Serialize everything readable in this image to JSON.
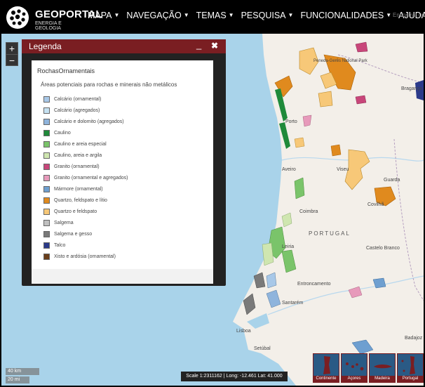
{
  "brand": {
    "title": "GEOPORTAL",
    "subtitle": "ENERGIA E GEOLOGIA"
  },
  "nav": {
    "items": [
      {
        "label": "MAPA",
        "dropdown": true
      },
      {
        "label": "NAVEGAÇÃO",
        "dropdown": true
      },
      {
        "label": "TEMAS",
        "dropdown": true
      },
      {
        "label": "PESQUISA",
        "dropdown": true
      },
      {
        "label": "FUNCIONALIDADES",
        "dropdown": true
      },
      {
        "label": "AJUDA",
        "dropdown": false
      }
    ],
    "search_placeholder": "Encontrar um"
  },
  "zoom": {
    "in": "+",
    "out": "−"
  },
  "legend": {
    "title": "Legenda",
    "minimize": "_",
    "close": "✖",
    "layer_name": "RochasOrnamentais",
    "subtitle": "Áreas potenciais para rochas e minerais não metálicos",
    "items": [
      {
        "label": "Calcário (ornamental)",
        "color": "#a8c8e8"
      },
      {
        "label": "Calcário (agregados)",
        "color": "#c6e2f2"
      },
      {
        "label": "Calcário e dolomito (agregados)",
        "color": "#8fb4dc"
      },
      {
        "label": "Caulino",
        "color": "#1f8a3a"
      },
      {
        "label": "Caulino e areia especial",
        "color": "#7ac46a"
      },
      {
        "label": "Caulino, areia e argila",
        "color": "#cfe6b0"
      },
      {
        "label": "Granito (ornamental)",
        "color": "#c8467a"
      },
      {
        "label": "Granito (ornamental e agregados)",
        "color": "#e79abb"
      },
      {
        "label": "Mármore (ornamental)",
        "color": "#6e9fd0"
      },
      {
        "label": "Quartzo, feldspato e lítio",
        "color": "#e08a1e"
      },
      {
        "label": "Quartzo e feldspato",
        "color": "#f7c878"
      },
      {
        "label": "Salgema",
        "color": "#c0c0c0"
      },
      {
        "label": "Salgema e gesso",
        "color": "#7a7a7a"
      },
      {
        "label": "Talco",
        "color": "#2b3a8a"
      },
      {
        "label": "Xisto e ardósia (ornamental)",
        "color": "#6a3e1a"
      }
    ]
  },
  "map": {
    "places": [
      "Porto",
      "Aveiro",
      "Viseu",
      "Guarda",
      "Covilhã",
      "Coimbra",
      "PORTUGAL",
      "Castelo Branco",
      "Leiria",
      "Santarém",
      "Lisboa",
      "Entroncamento",
      "Badajoz",
      "Bragança",
      "Peneda-Gerês National Park",
      "Setúbal"
    ]
  },
  "scale": {
    "km": "40 km",
    "mi": "20 mi"
  },
  "coords": "Scale 1:2311162 | Long: -12.461 Lat: 41.000",
  "regions": [
    "Continente",
    "Açores",
    "Madeira",
    "Portugal"
  ]
}
